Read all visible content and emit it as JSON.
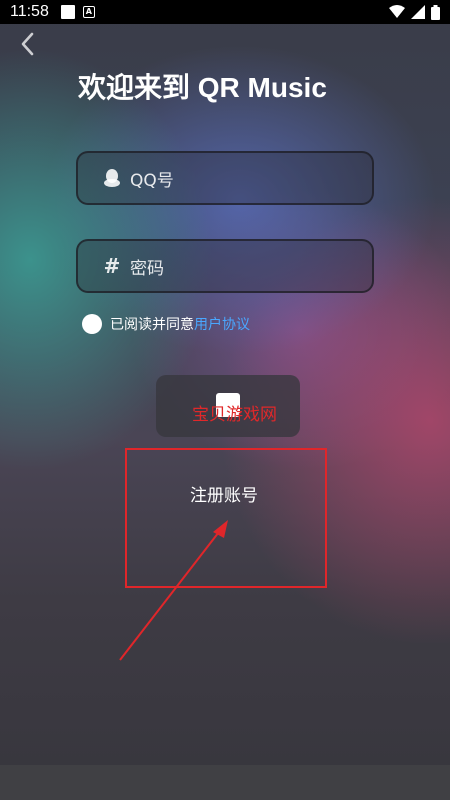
{
  "status": {
    "time": "11:58"
  },
  "page": {
    "title": "欢迎来到 QR Music",
    "qq_placeholder": "QQ号",
    "password_placeholder": "密码",
    "agree_text": "已阅读并同意",
    "agree_link": "用户协议",
    "register_label": "注册账号",
    "watermark": "宝贝游戏网"
  },
  "colors": {
    "link": "#4aa7ff",
    "annotation": "#e0262a"
  },
  "icons": {
    "back": "chevron-left-icon",
    "qq": "qq-penguin-icon",
    "password": "hash-icon"
  }
}
